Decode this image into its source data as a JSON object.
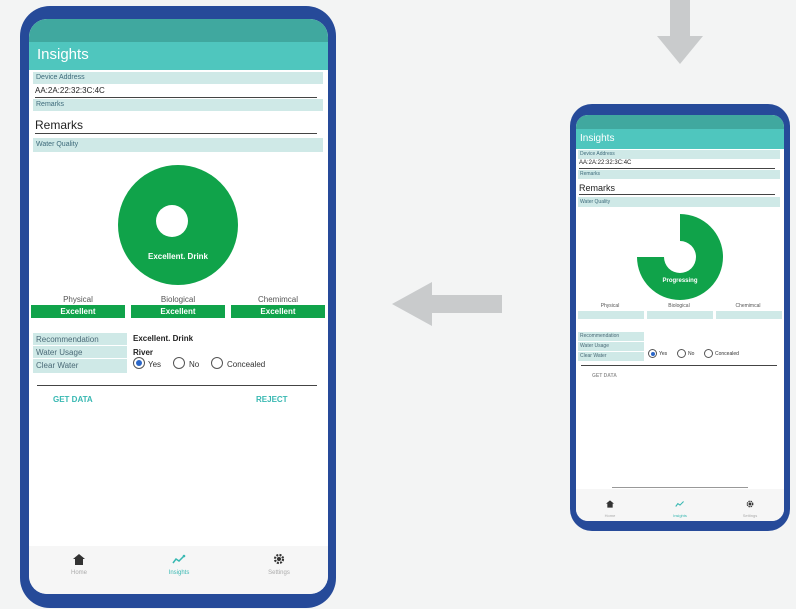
{
  "large_phone": {
    "title": "Insights",
    "device_address_label": "Device Address",
    "device_address_value": "AA:2A:22:32:3C:4C",
    "remarks_label": "Remarks",
    "remarks_value": "Remarks",
    "water_quality_label": "Water Quality",
    "gauge_label": "Excellent. Drink",
    "categories": [
      {
        "name": "Physical",
        "value": "Excellent"
      },
      {
        "name": "Biological",
        "value": "Excellent"
      },
      {
        "name": "Chemimcal",
        "value": "Excellent"
      }
    ],
    "recommendation_label": "Recommendation",
    "recommendation_value": "Excellent. Drink",
    "water_usage_label": "Water Usage",
    "water_usage_value": "River",
    "clear_water_label": "Clear Water",
    "options": [
      "Yes",
      "No",
      "Concealed"
    ],
    "selected_option": "Yes",
    "get_data": "GET DATA",
    "reject": "REJECT",
    "nav": [
      "Home",
      "Insights",
      "Settings"
    ]
  },
  "small_phone": {
    "title": "Insights",
    "device_address_label": "Device Address",
    "device_address_value": "AA:2A:22:32:3C:4C",
    "remarks_label": "Remarks",
    "remarks_value": "Remarks",
    "water_quality_label": "Water Quality",
    "gauge_label": "Progressing",
    "gauge_fill_fraction": 0.75,
    "categories": [
      "Physical",
      "Biological",
      "Chemimcal"
    ],
    "recommendation_label": "Recommendation",
    "water_usage_label": "Water Usage",
    "clear_water_label": "Clear Water",
    "options": [
      "Yes",
      "No",
      "Concealed"
    ],
    "get_data": "GET DATA",
    "nav": [
      "Home",
      "Insights",
      "Settings"
    ]
  },
  "colors": {
    "phone_frame": "#264a99",
    "app_bar": "#4fc6be",
    "field_bg": "#cfe9e7",
    "gauge_green": "#10a34a",
    "button_text": "#38b8b2",
    "arrow": "#c9cbcc"
  }
}
